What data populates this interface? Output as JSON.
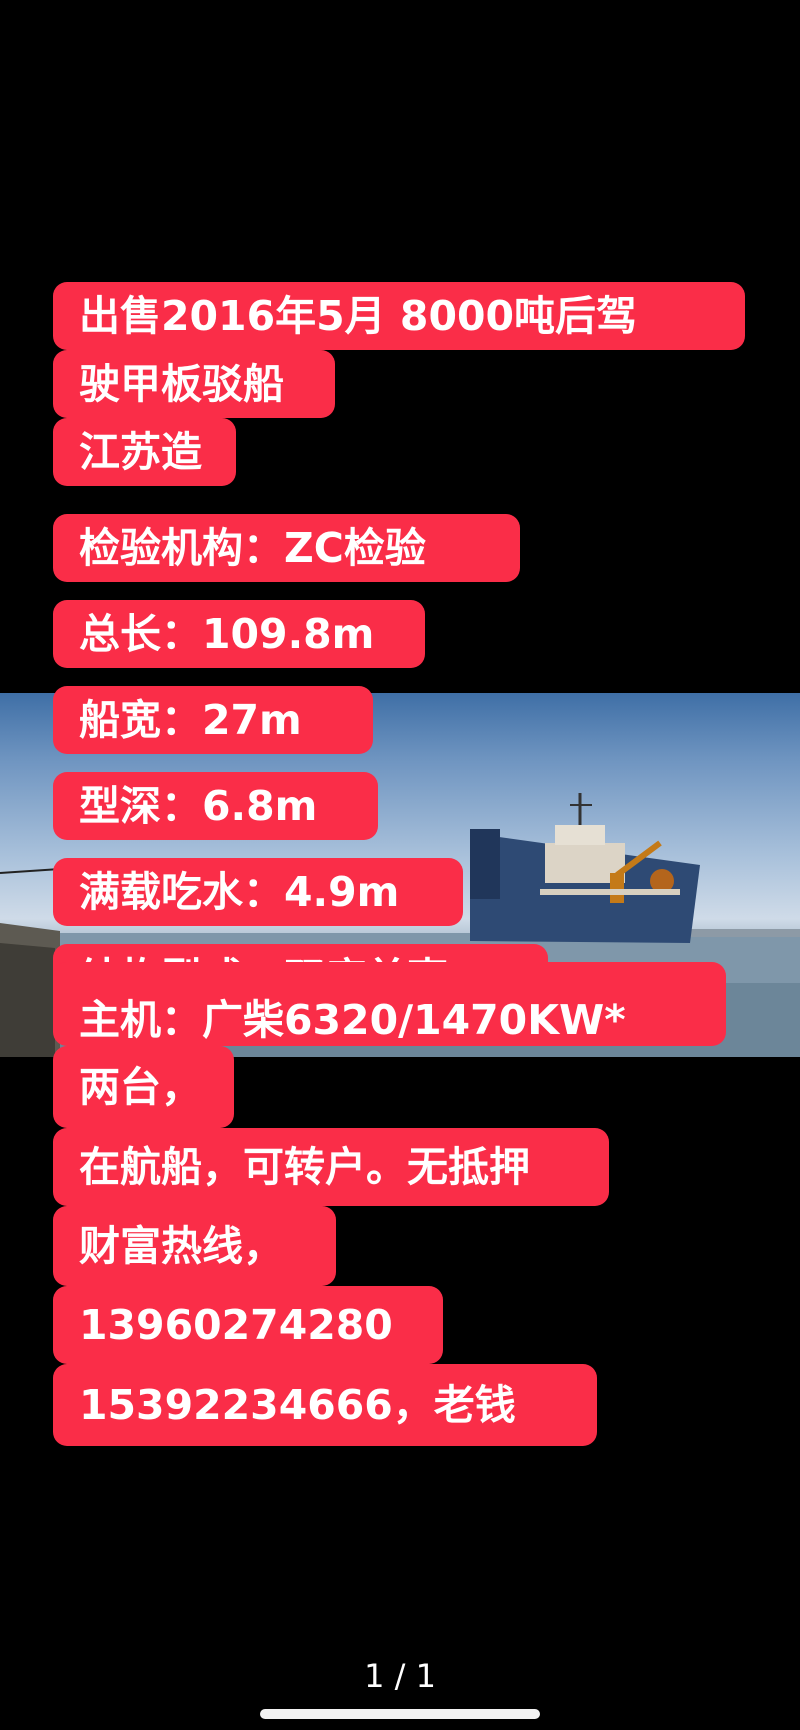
{
  "post": {
    "lines": [
      "出售2016年5月 8000吨后驾",
      "驶甲板驳船",
      "江苏造",
      "检验机构：ZC检验",
      "总长：109.8m",
      "船宽：27m",
      "型深：6.8m",
      "满载吃水：4.9m",
      "结构型式：双底单壳",
      "主机：广柴6320/1470KW*",
      "两台，",
      "在航船，可转户。无抵押",
      "财富热线，",
      "13960274280",
      "15392234666，老钱"
    ]
  },
  "viewer": {
    "page_indicator": "1 / 1"
  },
  "colors": {
    "highlight": "#fa2d48",
    "background": "#000000",
    "text": "#ffffff"
  }
}
